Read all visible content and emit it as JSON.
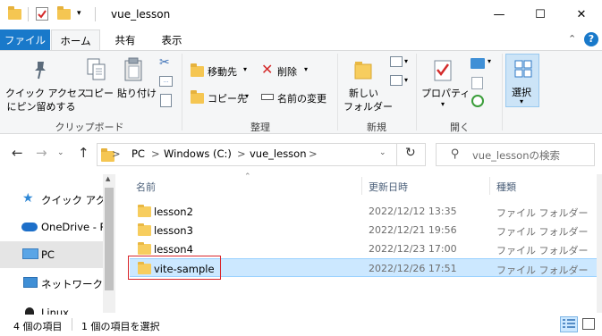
{
  "window": {
    "title": "vue_lesson",
    "controls": {
      "minimize": "—",
      "maximize": "☐",
      "close": "✕"
    }
  },
  "ribbon_tabs": [
    {
      "label": "ファイル"
    },
    {
      "label": "ホーム"
    },
    {
      "label": "共有"
    },
    {
      "label": "表示"
    }
  ],
  "ribbon": {
    "clipboard": {
      "pin_line1": "クイック アクセス",
      "pin_line2": "にピン留めする",
      "copy": "コピー",
      "paste": "貼り付け",
      "group_label": "クリップボード"
    },
    "organize": {
      "move_to": "移動先",
      "copy_to": "コピー先",
      "delete": "削除",
      "rename": "名前の変更",
      "group_label": "整理"
    },
    "new": {
      "folder_line1": "新しい",
      "folder_line2": "フォルダー",
      "group_label": "新規"
    },
    "open": {
      "properties": "プロパティ",
      "group_label": "開く"
    },
    "select": {
      "label": "選択"
    }
  },
  "address": {
    "crumbs": [
      "PC",
      "Windows (C:)",
      "vue_lesson"
    ],
    "separator": ">",
    "search_placeholder": "vue_lessonの検索"
  },
  "nav_pane": [
    {
      "label": "クイック アクセ",
      "icon": "star-icon"
    },
    {
      "label": "OneDrive - P",
      "icon": "cloud-icon"
    },
    {
      "label": "PC",
      "icon": "pc-icon",
      "selected": true
    },
    {
      "label": "ネットワーク",
      "icon": "network-icon"
    },
    {
      "label": "Linux",
      "icon": "linux-icon"
    }
  ],
  "file_list": {
    "columns": [
      "名前",
      "更新日時",
      "種類"
    ],
    "rows": [
      {
        "name": "lesson2",
        "date": "2022/12/12 13:35",
        "type": "ファイル フォルダー",
        "selected": false
      },
      {
        "name": "lesson3",
        "date": "2022/12/21 19:56",
        "type": "ファイル フォルダー",
        "selected": false
      },
      {
        "name": "lesson4",
        "date": "2022/12/23 17:00",
        "type": "ファイル フォルダー",
        "selected": false
      },
      {
        "name": "vite-sample",
        "date": "2022/12/26 17:51",
        "type": "ファイル フォルダー",
        "selected": true
      }
    ]
  },
  "status_bar": {
    "item_count": "4 個の項目",
    "selected_count": "1 個の項目を選択"
  },
  "colors": {
    "accent": "#1979ca",
    "selection": "#cce8ff",
    "highlight_border": "#d9262b",
    "folder": "#f7cd5e"
  }
}
